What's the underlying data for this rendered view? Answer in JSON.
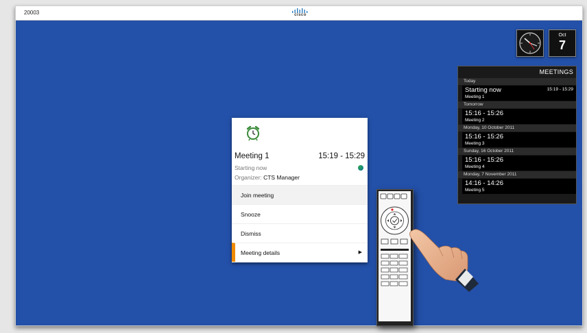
{
  "topbar": {
    "system_id": "20003",
    "logo_text": "cisco"
  },
  "clock": {
    "icon": "analog-clock-icon"
  },
  "date": {
    "month": "Oct",
    "day": "7"
  },
  "meetings_panel": {
    "title": "MEETINGS",
    "sections": [
      {
        "label": "Today",
        "items": [
          {
            "main": "Starting now",
            "sub": "Meeting 1",
            "time": "15:19 - 15:29"
          }
        ]
      },
      {
        "label": "Tomorrow",
        "items": [
          {
            "main": "15:16 - 15:26",
            "sub": "Meeting 2"
          }
        ]
      },
      {
        "label": "Monday, 10 October 2011",
        "items": [
          {
            "main": "15:16 - 15:26",
            "sub": "Meeting 3"
          }
        ]
      },
      {
        "label": "Sunday, 16 October 2011",
        "items": [
          {
            "main": "15:16 - 15:26",
            "sub": "Meeting 4"
          }
        ]
      },
      {
        "label": "Monday, 7 November 2011",
        "items": [
          {
            "main": "14:16 - 14:26",
            "sub": "Meeting 5"
          }
        ]
      }
    ]
  },
  "reminder": {
    "icon": "alarm-clock-icon",
    "title": "Meeting 1",
    "time": "15:19 - 15:29",
    "status": "Starting now",
    "organizer_label": "Organizer:",
    "organizer": "CTS Manager",
    "actions": [
      {
        "label": "Join meeting"
      },
      {
        "label": "Snooze"
      },
      {
        "label": "Dismiss"
      },
      {
        "label": "Meeting details"
      }
    ],
    "accent": "#f08a00"
  },
  "colors": {
    "background": "#2350a8"
  }
}
